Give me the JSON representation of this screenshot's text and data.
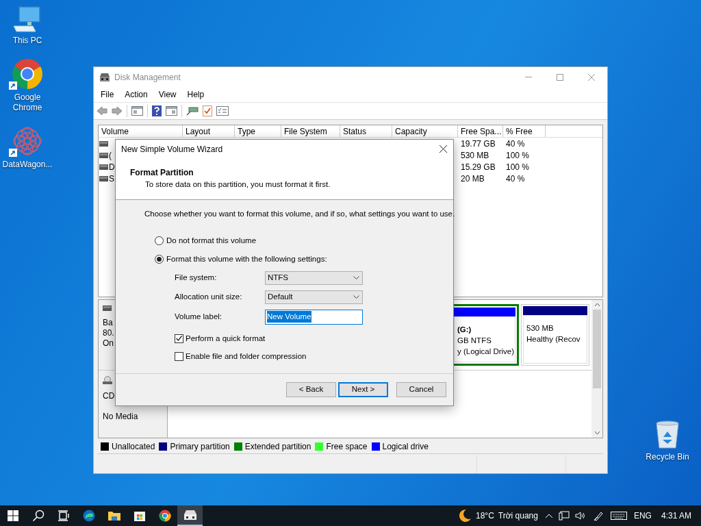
{
  "desktop_icons": [
    {
      "kind": "pc",
      "label": "This PC"
    },
    {
      "kind": "chrome",
      "label": "Google Chrome",
      "shortcut": true
    },
    {
      "kind": "flower",
      "label": "DataWagon...",
      "shortcut": true
    },
    {
      "kind": "bin",
      "label": "Recycle Bin"
    }
  ],
  "window": {
    "title": "Disk Management",
    "menu": [
      "File",
      "Action",
      "View",
      "Help"
    ],
    "volume_table": {
      "columns": [
        "Volume",
        "Layout",
        "Type",
        "File System",
        "Status",
        "Capacity",
        "Free Spa...",
        "% Free"
      ],
      "rows": [
        {
          "free_space": "19.77 GB",
          "percent_free": "40 %"
        },
        {
          "volume": "(",
          "free_space": "530 MB",
          "percent_free": "100 %"
        },
        {
          "volume": "D",
          "free_space": "15.29 GB",
          "percent_free": "100 %"
        },
        {
          "volume": "S",
          "free_space": "20 MB",
          "percent_free": "40 %"
        }
      ]
    },
    "disks": [
      {
        "kind": "hdd",
        "lines": [
          "Ba",
          "80.",
          "On"
        ],
        "partitions": [
          {
            "lines": [
              "(G:)",
              "GB NTFS",
              "y (Logical Drive)"
            ],
            "color": "#0000ff",
            "framed": true
          },
          {
            "lines": [
              "530 MB",
              "Healthy (Recov"
            ],
            "color": "#000080",
            "framed": false
          }
        ]
      },
      {
        "kind": "cd",
        "lines": [
          "CD",
          "No Media"
        ]
      }
    ],
    "legend": [
      {
        "label": "Unallocated",
        "color": "#000000"
      },
      {
        "label": "Primary partition",
        "color": "#000080"
      },
      {
        "label": "Extended partition",
        "color": "#008000"
      },
      {
        "label": "Free space",
        "color": "#33ff33"
      },
      {
        "label": "Logical drive",
        "color": "#0000ff"
      }
    ]
  },
  "dialog": {
    "title": "New Simple Volume Wizard",
    "heading": "Format Partition",
    "subheading": "To store data on this partition, you must format it first.",
    "prompt": "Choose whether you want to format this volume, and if so, what settings you want to use.",
    "format_options": [
      {
        "label": "Do not format this volume",
        "selected": false
      },
      {
        "label": "Format this volume with the following settings:",
        "selected": true
      }
    ],
    "fields": [
      {
        "kind": "select",
        "label": "File system:",
        "value": "NTFS"
      },
      {
        "kind": "select",
        "label": "Allocation unit size:",
        "value": "Default"
      },
      {
        "kind": "text",
        "label": "Volume label:",
        "value": "New Volume"
      }
    ],
    "checkboxes": [
      {
        "label": "Perform a quick format",
        "checked": true
      },
      {
        "label": "Enable file and folder compression",
        "checked": false
      }
    ],
    "buttons": [
      {
        "label": "< Back",
        "default": false
      },
      {
        "label": "Next >",
        "default": true
      },
      {
        "label": "Cancel",
        "default": false
      }
    ]
  },
  "taskbar": {
    "apps": [
      {
        "kind": "search",
        "active": false
      },
      {
        "kind": "taskview",
        "active": false
      },
      {
        "kind": "edge",
        "active": false
      },
      {
        "kind": "explorer",
        "active": false
      },
      {
        "kind": "store",
        "active": false
      },
      {
        "kind": "chrome",
        "active": false
      },
      {
        "kind": "disk",
        "active": true
      }
    ],
    "temperature": "18°C",
    "weather": "Trời quang",
    "language": "ENG",
    "time": "4:31 AM"
  }
}
